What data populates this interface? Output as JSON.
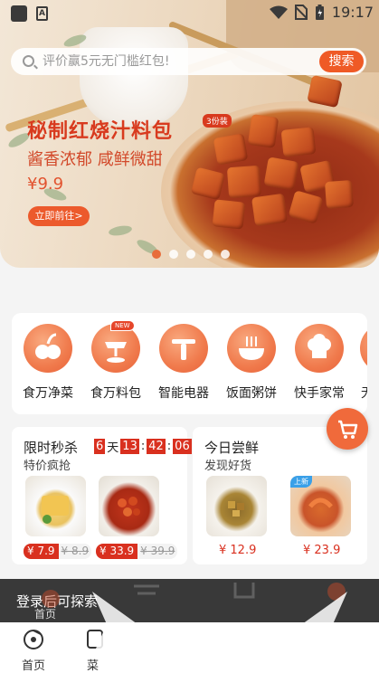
{
  "status_bar": {
    "time": "19:17"
  },
  "search": {
    "placeholder": "评价赢5元无门槛红包!",
    "button_label": "搜索"
  },
  "banner": {
    "title": "秘制红烧汁料包",
    "tag": "3份装",
    "subtitle": "酱香浓郁 咸鲜微甜",
    "price": "¥9.9",
    "cta_label": "立即前往>",
    "slides": 5,
    "active_slide": 0
  },
  "categories": [
    {
      "label": "食万净菜",
      "icon": "vegetables-icon",
      "badge": ""
    },
    {
      "label": "食万料包",
      "icon": "sauce-pack-icon",
      "badge": "NEW"
    },
    {
      "label": "智能电器",
      "icon": "appliance-icon",
      "badge": ""
    },
    {
      "label": "饭面粥饼",
      "icon": "noodle-bowl-icon",
      "badge": ""
    },
    {
      "label": "快手家常",
      "icon": "chef-hat-icon",
      "badge": ""
    },
    {
      "label": "无",
      "icon": "more-icon",
      "badge": ""
    }
  ],
  "flash_sale": {
    "title": "限时秒杀",
    "subtitle": "特价疯抢",
    "countdown": {
      "days": "6",
      "day_unit": "天",
      "hours": "13",
      "minutes": "42",
      "seconds": "06"
    },
    "products": [
      {
        "price": "¥ 7.9",
        "old_price": "¥ 8.9"
      },
      {
        "price": "¥ 33.9",
        "old_price": "¥ 39.9"
      }
    ]
  },
  "fresh": {
    "title": "今日尝鲜",
    "subtitle": "发现好货",
    "products": [
      {
        "price": "¥ 12.9",
        "badge": ""
      },
      {
        "price": "¥ 23.9",
        "badge": "上新"
      }
    ]
  },
  "toast": {
    "text": "登录后可探索"
  },
  "tabbar": [
    {
      "label": "首页",
      "icon": "home-icon"
    },
    {
      "label": "菜",
      "icon": "recipe-icon"
    }
  ],
  "ghost_labels": {
    "home": "首页"
  },
  "colors": {
    "accent": "#ef5a26",
    "sale_red": "#d9301f"
  }
}
